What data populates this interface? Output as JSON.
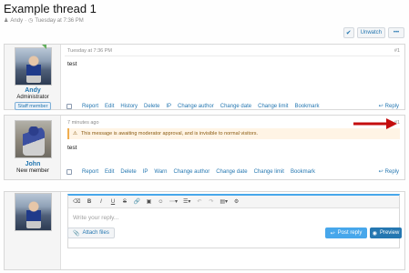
{
  "thread": {
    "title": "Example thread 1",
    "author": "Andy",
    "date": "Tuesday at 7:36 PM"
  },
  "toolbar": {
    "unwatch_label": "Unwatch",
    "more_label": "•••"
  },
  "posts": [
    {
      "username": "Andy",
      "user_title": "Administrator",
      "badge": "Staff member",
      "time": "Tuesday at 7:36 PM",
      "number": "#1",
      "text": "test",
      "actions": [
        "Report",
        "Edit",
        "History",
        "Delete",
        "IP",
        "Change author",
        "Change date",
        "Change limit",
        "Bookmark"
      ],
      "reply_label": "Reply"
    },
    {
      "username": "John",
      "user_title": "New member",
      "time": "7 minutes ago",
      "number": "#1",
      "notice": "This message is awaiting moderator approval, and is invisible to normal visitors.",
      "text": "test",
      "actions": [
        "Report",
        "Edit",
        "Delete",
        "IP",
        "Warn",
        "Change author",
        "Change date",
        "Change limit",
        "Bookmark"
      ],
      "reply_label": "Reply"
    }
  ],
  "editor": {
    "placeholder": "Write your reply...",
    "attach_label": "Attach files",
    "post_reply_label": "Post reply",
    "preview_label": "Preview"
  },
  "colors": {
    "accent": "#2577b1",
    "button_blue": "#47a7eb",
    "arrow_red": "#c40d0d",
    "notice_bg": "#fff4e5"
  }
}
